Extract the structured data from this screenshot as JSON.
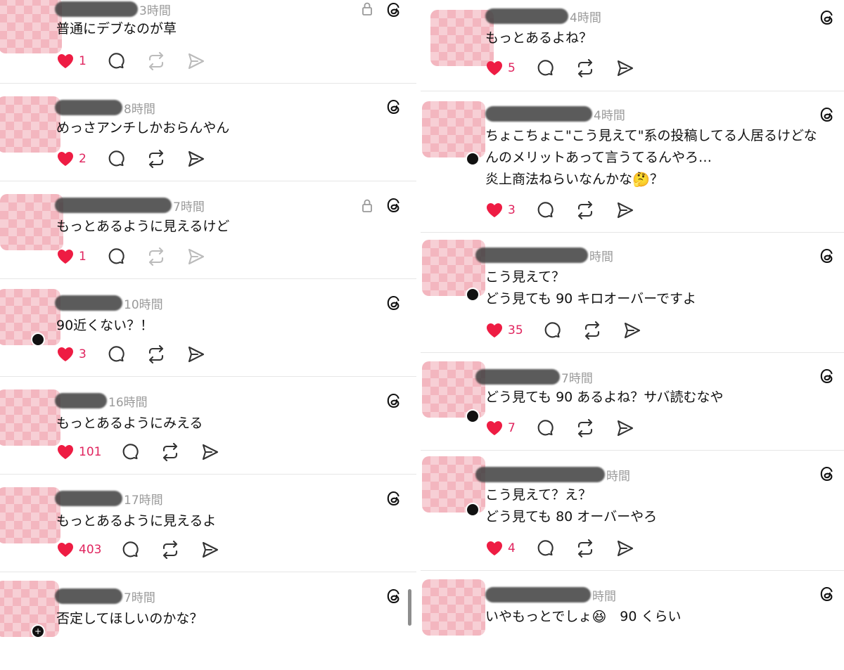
{
  "app": {
    "brand_icon": "threads-icon",
    "like_color": "#e0245e",
    "avatar_color": "#f3b6bf"
  },
  "left": [
    {
      "time": "3時間",
      "text": [
        "普通にデブなのが草"
      ],
      "likes": "1",
      "locked": true
    },
    {
      "time": "8時間",
      "text": [
        "めっさアンチしかおらんやん"
      ],
      "likes": "2",
      "locked": false
    },
    {
      "time": "7時間",
      "text": [
        "もっとあるように見えるけど"
      ],
      "likes": "1",
      "locked": true
    },
    {
      "time": "10時間",
      "text": [
        "90近くない？！"
      ],
      "likes": "3",
      "locked": false
    },
    {
      "time": "16時間",
      "text": [
        "もっとあるようにみえる"
      ],
      "likes": "101",
      "locked": false
    },
    {
      "time": "17時間",
      "text": [
        "もっとあるように見えるよ"
      ],
      "likes": "403",
      "locked": false
    },
    {
      "time": "7時間",
      "text": [
        "否定してほしいのかな？"
      ],
      "likes": "",
      "locked": false
    }
  ],
  "right": [
    {
      "time": "4時間",
      "text": [
        "もっとあるよね？"
      ],
      "likes": "5"
    },
    {
      "time": "4時間",
      "text": [
        "ちょこちょこ\"こう見えて\"系の投稿してる人居るけどな",
        "んのメリットあって言うてるんやろ…",
        "炎上商法ねらいなんかな"
      ],
      "emoji": "🤔",
      "emoji_after": "？",
      "likes": "3"
    },
    {
      "time": "時間",
      "text": [
        "こう見えて？",
        "どう見ても 90 キロオーバーですよ"
      ],
      "likes": "35"
    },
    {
      "time": "7時間",
      "text": [
        "どう見ても 90 あるよね？サバ読むなや"
      ],
      "likes": "7"
    },
    {
      "time": "時間",
      "text": [
        "こう見えて？え？",
        "どう見ても 80 オーバーやろ"
      ],
      "likes": "4"
    },
    {
      "time": "時間",
      "text": [
        "いやもっとでしょ"
      ],
      "emoji": "😆",
      "emoji_after": "　90 くらい",
      "likes": ""
    }
  ]
}
